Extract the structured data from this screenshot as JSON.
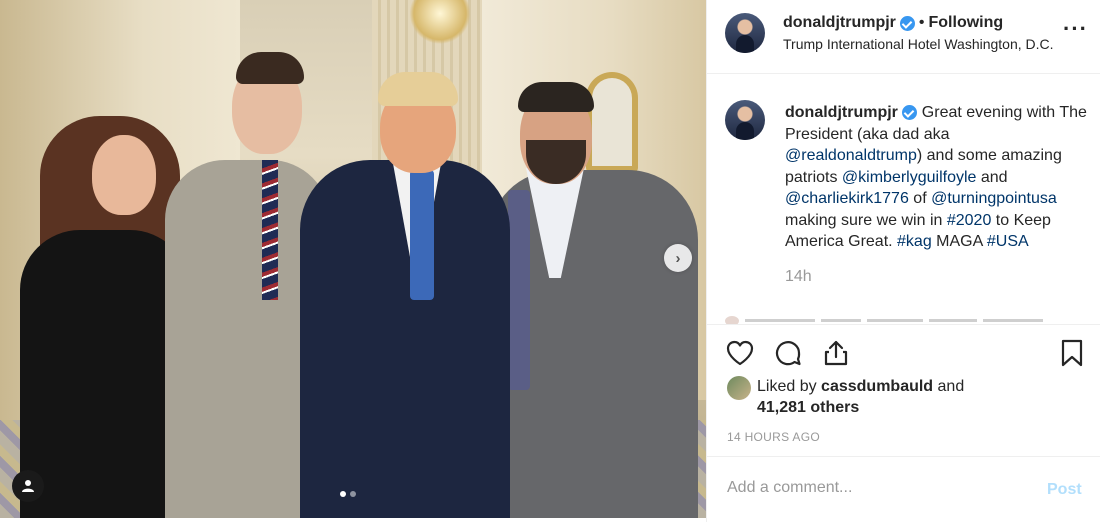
{
  "post": {
    "username": "donaldjtrumpjr",
    "separator": "•",
    "follow_status": "Following",
    "location": "Trump International Hotel Washington, D.C.",
    "more_icon": "more-options-icon",
    "caption": {
      "username": "donaldjtrumpjr",
      "text_1": "Great evening with The President (aka dad aka ",
      "mention_1": "@realdonaldtrump",
      "text_2": ") and some amazing patriots ",
      "mention_2": "@kimberlyguilfoyle",
      "text_3": " and ",
      "mention_3": "@charliekirk1776",
      "text_4": " of ",
      "mention_4": "@turningpointusa",
      "text_5": " making sure we win in ",
      "hashtag_1": "#2020",
      "text_6": " to Keep America Great. ",
      "hashtag_2": "#kag",
      "text_7": " MAGA ",
      "hashtag_3": "#USA"
    },
    "caption_time": "14h",
    "likes": {
      "prefix": "Liked by ",
      "user": "cassdumbauld",
      "middle": " and",
      "count": "41,281 others"
    },
    "timestamp": "14 HOURS AGO",
    "comment": {
      "placeholder": "Add a comment...",
      "post_label": "Post"
    }
  },
  "media": {
    "carousel_total": 2,
    "carousel_active": 1
  },
  "colors": {
    "link": "#003569",
    "verified": "#3897f0",
    "muted": "#999999",
    "post_disabled": "#b2dffc"
  }
}
